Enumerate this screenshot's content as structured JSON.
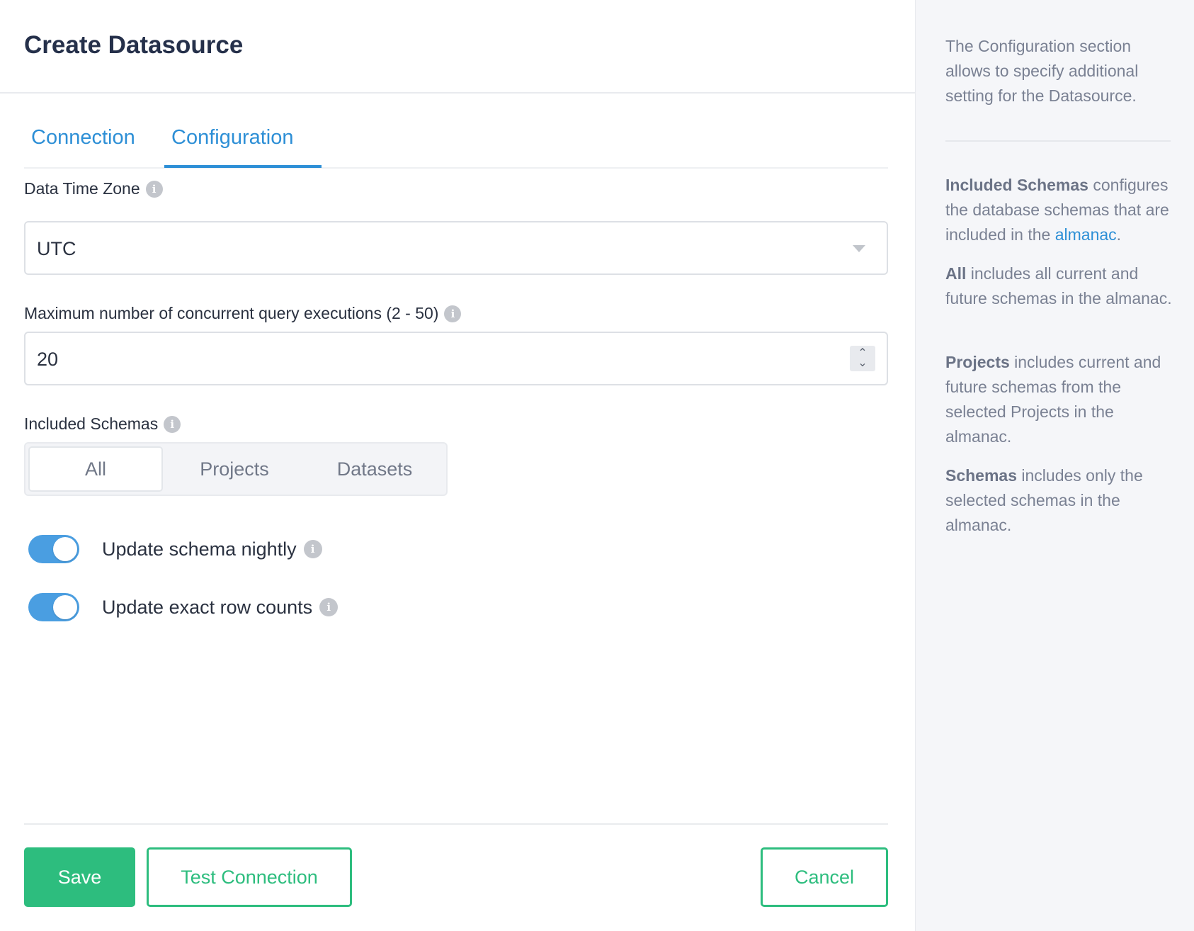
{
  "header": {
    "title": "Create Datasource"
  },
  "tabs": [
    {
      "label": "Connection"
    },
    {
      "label": "Configuration"
    }
  ],
  "form": {
    "timezone": {
      "label": "Data Time Zone",
      "value": "UTC"
    },
    "concurrency": {
      "label": "Maximum number of concurrent query executions (2 - 50)",
      "value": "20"
    },
    "schemas": {
      "label": "Included Schemas",
      "options": [
        "All",
        "Projects",
        "Datasets"
      ],
      "selected": "All"
    },
    "toggles": [
      {
        "label": "Update schema nightly",
        "on": true
      },
      {
        "label": "Update exact row counts",
        "on": true
      }
    ]
  },
  "footer": {
    "save_label": "Save",
    "test_label": "Test Connection",
    "cancel_label": "Cancel"
  },
  "sidebar": {
    "intro": "The Configuration section allows to specify additional setting for the Datasource.",
    "p1": {
      "bold": "Included Schemas",
      "text": " configures the database schemas that are included in the ",
      "link": "almanac",
      "end": "."
    },
    "p2": {
      "bold": "All",
      "text": " includes all current and future schemas in the almanac."
    },
    "p3": {
      "bold": "Projects",
      "text": " includes current and future schemas from the selected Projects in the almanac."
    },
    "p4": {
      "bold": "Schemas",
      "text": " includes only the selected schemas in the almanac."
    }
  },
  "colors": {
    "accent": "#2d8fd6",
    "success": "#2dbd7e",
    "toggle": "#4a9ee1"
  },
  "icons": {
    "info": "info-icon",
    "dropdown": "chevron-down-icon",
    "spinner": "stepper-icon"
  }
}
